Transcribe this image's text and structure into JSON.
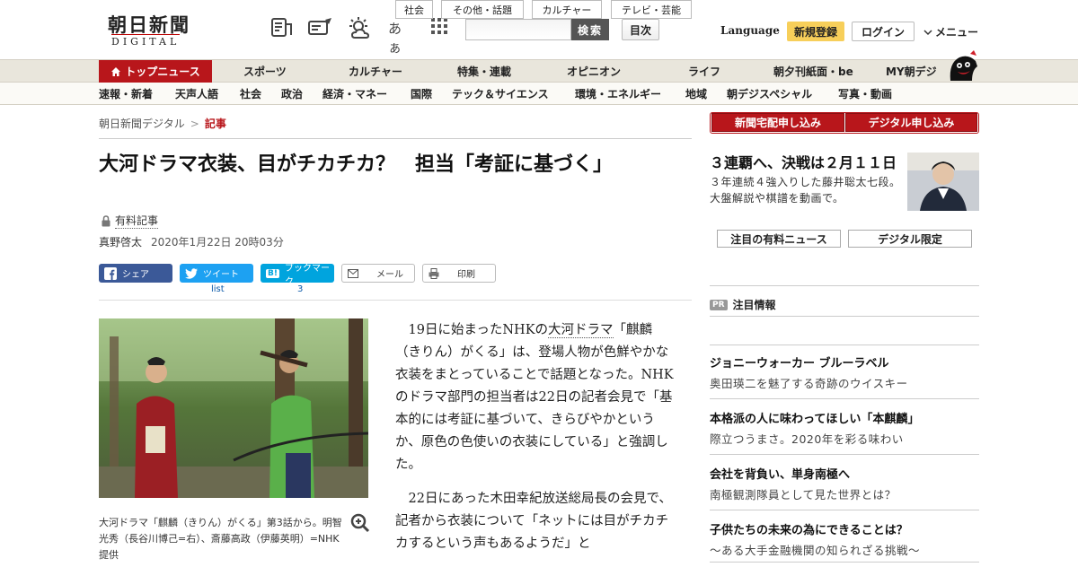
{
  "header": {
    "logo_main": "朝日新聞",
    "logo_sub": "DIGITAL",
    "icons": [
      "newspaper-icon",
      "paper-plane-icon",
      "weather-icon",
      "font-size-icon",
      "grid-icon"
    ],
    "font_size_label": "あぁ",
    "search": {
      "placeholder": "",
      "button_label": "検索"
    },
    "index_label": "目次",
    "language_label": "Language",
    "signup_label": "新規登録",
    "login_label": "ログイン",
    "menu_label": "メニュー"
  },
  "nav_primary": {
    "items": [
      "トップニュース",
      "スポーツ",
      "カルチャー",
      "特集・連載",
      "オピニオン",
      "ライフ",
      "朝夕刊紙面・be",
      "MY朝デジ"
    ],
    "active_index": 0
  },
  "nav_secondary": {
    "items": [
      "速報・新着",
      "天声人語",
      "社会",
      "政治",
      "経済・マネー",
      "国際",
      "テック＆サイエンス",
      "環境・エネルギー",
      "地域",
      "朝デジスペシャル",
      "写真・動画"
    ]
  },
  "breadcrumb": {
    "home": "朝日新聞デジタル",
    "separator": ">",
    "current": "記事"
  },
  "article_tags": [
    "社会",
    "その他・話題",
    "カルチャー",
    "テレビ・芸能"
  ],
  "article": {
    "title": "大河ドラマ衣装、目がチカチカ？　担当「考証に基づく」",
    "paid_label": "有料記事",
    "author": "真野啓太",
    "date": "2020年1月22日 20時03分",
    "share": {
      "facebook": "シェア",
      "twitter": "ツイート",
      "hatena": "ブックマーク",
      "mail": "メール",
      "print": "印刷",
      "twitter_count": "list",
      "hatena_count": "3"
    },
    "caption": "大河ドラマ「麒麟（きりん）がくる」第3話から。明智光秀（長谷川博己=右）、斎藤高政（伊藤英明）=NHK提供",
    "paragraph1_a": "19日に始まったNHKの",
    "paragraph1_link": "大河ドラマ",
    "paragraph1_b": "「麒麟（きりん）がくる」は、登場人物が色鮮やかな衣装をまとっていることで話題となった。NHKのドラマ部門の担当者は22日の記者会見で「基本的には考証に基づいて、きらびやかというか、原色の色使いの衣装にしている」と強調した。",
    "paragraph2": "22日にあった木田幸紀放送総局長の会見で、記者から衣装について「ネットには目がチカチカするという声もあるようだ」と"
  },
  "sidebar": {
    "buttons": [
      "新聞宅配申し込み",
      "デジタル申し込み"
    ],
    "promo_title": "３連覇へ、決戦は２月１１日",
    "promo_text": "３年連続４強入りした藤井聡太七段。大盤解説や棋譜を動画で。",
    "tabs": [
      "注目の有料ニュース",
      "デジタル限定"
    ],
    "pr_badge": "PR",
    "pr_heading": "注目情報",
    "pr_items": [
      {
        "title": "ジョニーウォーカー ブルーラベル",
        "sub": "奥田瑛二を魅了する奇跡のウイスキー"
      },
      {
        "title": "本格派の人に味わってほしい「本麒麟」",
        "sub": "際立つうまさ。2020年を彩る味わい"
      },
      {
        "title": "会社を背負い、単身南極へ",
        "sub": "南極観測隊員として見た世界とは？"
      },
      {
        "title": "子供たちの未来の為にできることは？",
        "sub": "～ある大手金融機関の知られざる挑戦～"
      }
    ]
  },
  "colors": {
    "brand_red": "#b8161b",
    "signup_yellow": "#f7cf5a",
    "facebook": "#3b5998",
    "twitter": "#1da1f2",
    "hatena": "#00a4de"
  }
}
